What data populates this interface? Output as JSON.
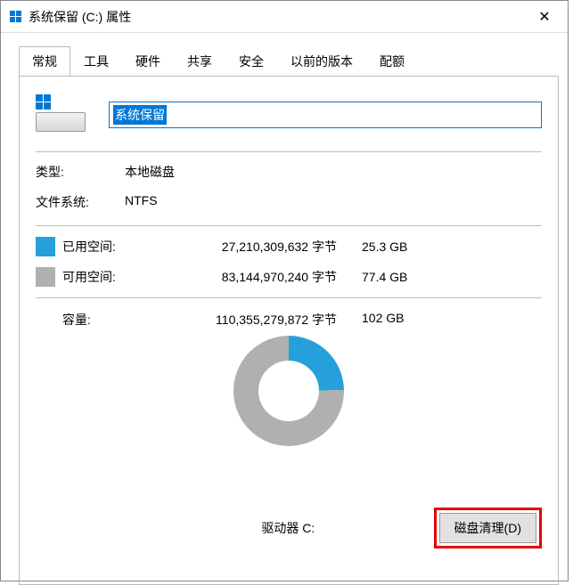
{
  "window": {
    "title": "系统保留 (C:) 属性"
  },
  "tabs": {
    "general": "常规",
    "tools": "工具",
    "hardware": "硬件",
    "sharing": "共享",
    "security": "安全",
    "previous": "以前的版本",
    "quota": "配额"
  },
  "drive": {
    "name": "系统保留",
    "type_label": "类型:",
    "type_value": "本地磁盘",
    "fs_label": "文件系统:",
    "fs_value": "NTFS"
  },
  "space": {
    "used_label": "已用空间:",
    "used_bytes": "27,210,309,632 字节",
    "used_gb": "25.3 GB",
    "free_label": "可用空间:",
    "free_bytes": "83,144,970,240 字节",
    "free_gb": "77.4 GB",
    "capacity_label": "容量:",
    "capacity_bytes": "110,355,279,872 字节",
    "capacity_gb": "102 GB"
  },
  "footer": {
    "drive_label": "驱动器 C:",
    "cleanup_btn": "磁盘清理(D)"
  },
  "colors": {
    "used": "#26a0da",
    "free": "#b0b0b0"
  },
  "chart_data": {
    "type": "pie",
    "title": "驱动器 C:",
    "series": [
      {
        "name": "已用空间",
        "value": 25.3,
        "unit": "GB",
        "color": "#26a0da"
      },
      {
        "name": "可用空间",
        "value": 77.4,
        "unit": "GB",
        "color": "#b0b0b0"
      }
    ],
    "total": {
      "label": "容量",
      "value": 102,
      "unit": "GB"
    }
  }
}
